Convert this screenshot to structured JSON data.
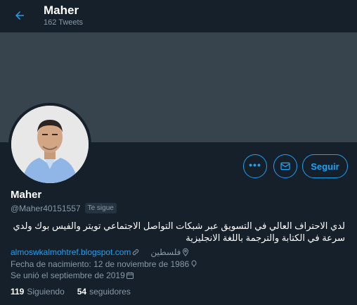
{
  "header": {
    "name": "Maher",
    "tweet_count": "162 Tweets",
    "back_icon": "arrow-left-icon"
  },
  "colors": {
    "background": "#15202b",
    "banner": "#38444d",
    "accent": "#1da1f2",
    "secondary_text": "#8899a6"
  },
  "profile": {
    "name": "Maher",
    "handle": "@Maher40151557",
    "follows_you": "Te sigue",
    "bio": "لدي الاحتراف العالي في التسويق عبر شبكات التواصل الاجتماعي تويتر والفيس بوك ولدي سرعة في الكتابة والترجمة باللغة الانجليزية",
    "location": "فلسطين",
    "website": "almoswkalmohtref.blogspot.com",
    "birth": "Fecha de nacimiento: 12 de noviembre de 1986",
    "joined": "Se unió el septiembre de 2019"
  },
  "actions": {
    "more_label": "•••",
    "follow_label": "Seguir"
  },
  "stats": {
    "following_count": "119",
    "following_label": "Siguiendo",
    "followers_count": "54",
    "followers_label": "seguidores"
  }
}
